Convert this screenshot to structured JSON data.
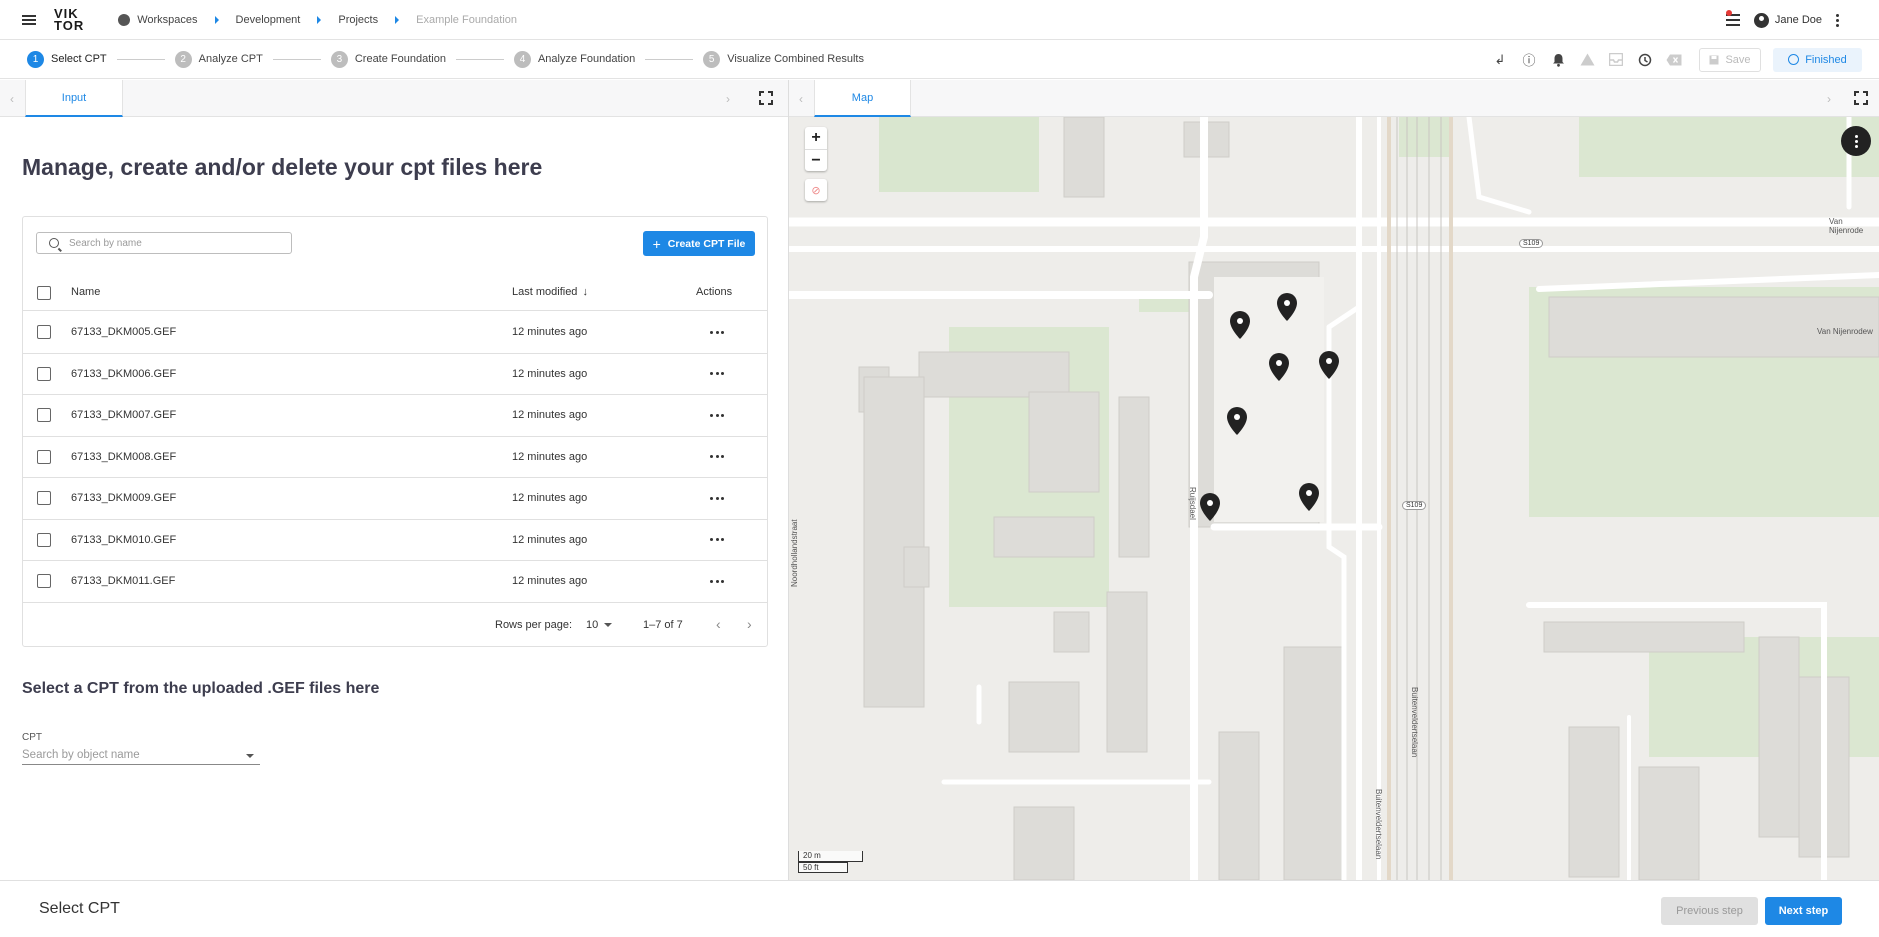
{
  "header": {
    "logo_line1": "VIK",
    "logo_line2": "TOR",
    "breadcrumbs": [
      "Workspaces",
      "Development",
      "Projects",
      "Example Foundation"
    ],
    "user_name": "Jane Doe"
  },
  "stepper": {
    "steps": [
      {
        "num": "1",
        "label": "Select CPT"
      },
      {
        "num": "2",
        "label": "Analyze CPT"
      },
      {
        "num": "3",
        "label": "Create Foundation"
      },
      {
        "num": "4",
        "label": "Analyze Foundation"
      },
      {
        "num": "5",
        "label": "Visualize Combined Results"
      }
    ],
    "save_label": "Save",
    "finished_label": "Finished"
  },
  "left_panel": {
    "tab_label": "Input",
    "title": "Manage, create and/or delete your cpt files here",
    "search_placeholder": "Search by name",
    "create_button": "Create CPT File",
    "columns": {
      "name": "Name",
      "modified": "Last modified",
      "actions": "Actions"
    },
    "rows": [
      {
        "name": "67133_DKM005.GEF",
        "modified": "12 minutes ago"
      },
      {
        "name": "67133_DKM006.GEF",
        "modified": "12 minutes ago"
      },
      {
        "name": "67133_DKM007.GEF",
        "modified": "12 minutes ago"
      },
      {
        "name": "67133_DKM008.GEF",
        "modified": "12 minutes ago"
      },
      {
        "name": "67133_DKM009.GEF",
        "modified": "12 minutes ago"
      },
      {
        "name": "67133_DKM010.GEF",
        "modified": "12 minutes ago"
      },
      {
        "name": "67133_DKM011.GEF",
        "modified": "12 minutes ago"
      }
    ],
    "pagination": {
      "rows_label": "Rows per page:",
      "rows_value": "10",
      "range": "1–7 of 7"
    },
    "section_title": "Select a CPT from the uploaded .GEF files here",
    "cpt_label": "CPT",
    "cpt_placeholder": "Search by object name"
  },
  "map_panel": {
    "tab_label": "Map",
    "zoom_in": "+",
    "zoom_out": "−",
    "scale_m": "20 m",
    "scale_ft": "50 ft",
    "road_labels": [
      "Van Nijenrode",
      "Van Nijenrodew",
      "Ruijsdael",
      "Noordhollandstraat",
      "Buitenveldertselaan",
      "Buitenveldertselaan"
    ],
    "road_badges": [
      "S109",
      "S109"
    ]
  },
  "footer": {
    "title": "Select CPT",
    "prev_label": "Previous step",
    "next_label": "Next step"
  }
}
